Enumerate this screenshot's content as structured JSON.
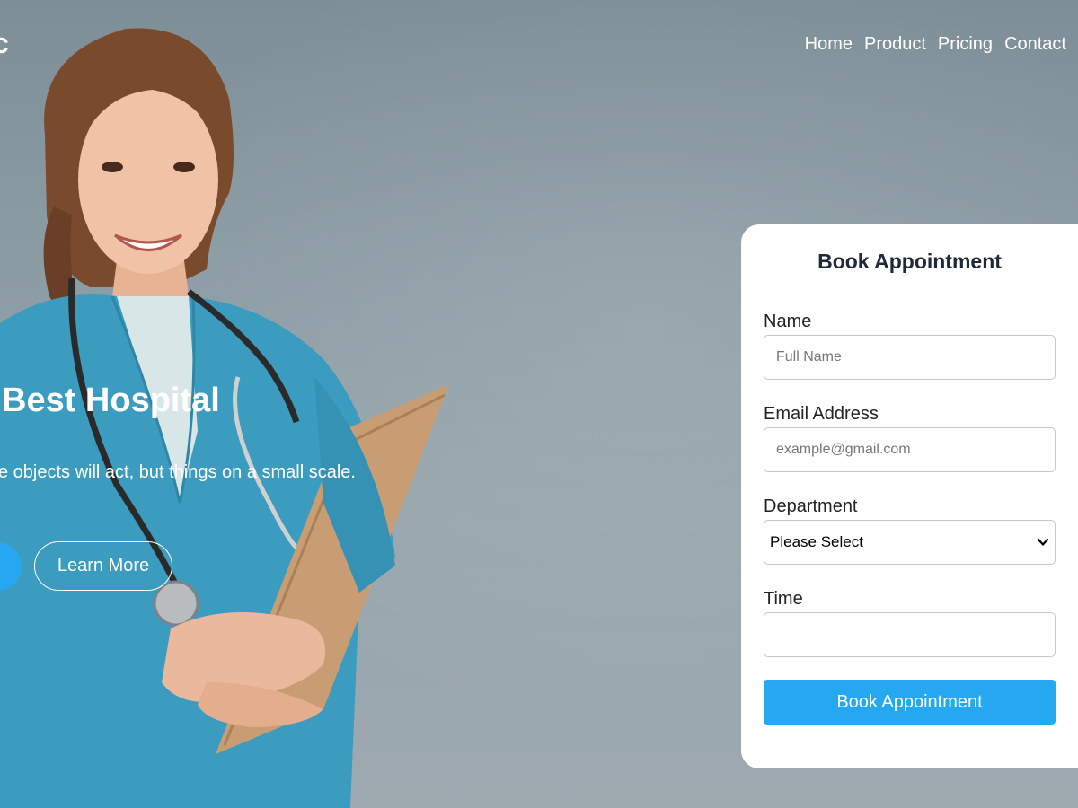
{
  "brand": {
    "logo_text": "c"
  },
  "nav": {
    "items": [
      {
        "label": "Home"
      },
      {
        "label": "Product"
      },
      {
        "label": "Pricing"
      },
      {
        "label": "Contact"
      }
    ]
  },
  "hero": {
    "headline": "Best Hospital",
    "subtext": "e objects will act, but things on a small scale.",
    "learn_more_label": "Learn More"
  },
  "appointment_form": {
    "title": "Book Appointment",
    "name_label": "Name",
    "name_placeholder": "Full Name",
    "email_label": "Email Address",
    "email_placeholder": "example@gmail.com",
    "department_label": "Department",
    "department_selected": "Please Select",
    "time_label": "Time",
    "time_value": "",
    "submit_label": "Book Appointment"
  },
  "colors": {
    "accent": "#26a8f0",
    "background": "#8b9ba3",
    "card": "#ffffff"
  }
}
